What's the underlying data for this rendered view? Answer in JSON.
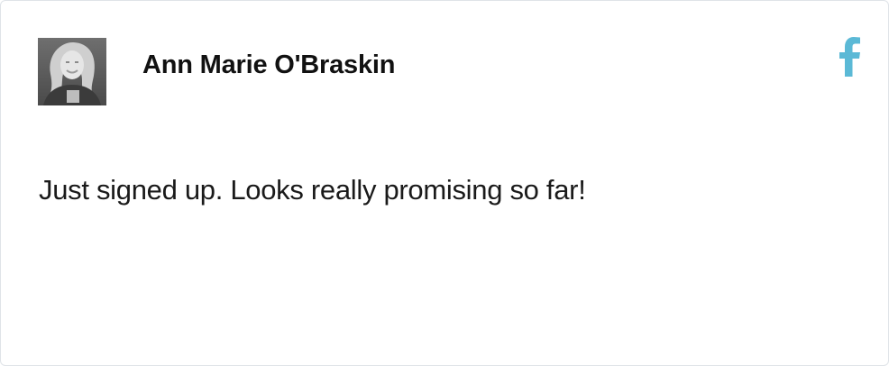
{
  "post": {
    "author_name": "Ann Marie O'Braskin",
    "message": "Just signed up. Looks really promising so far!",
    "avatar": {
      "icon": "user-photo",
      "alt": "Ann Marie O'Braskin"
    },
    "source": {
      "icon": "facebook-icon",
      "color": "#5bb9d6"
    }
  }
}
